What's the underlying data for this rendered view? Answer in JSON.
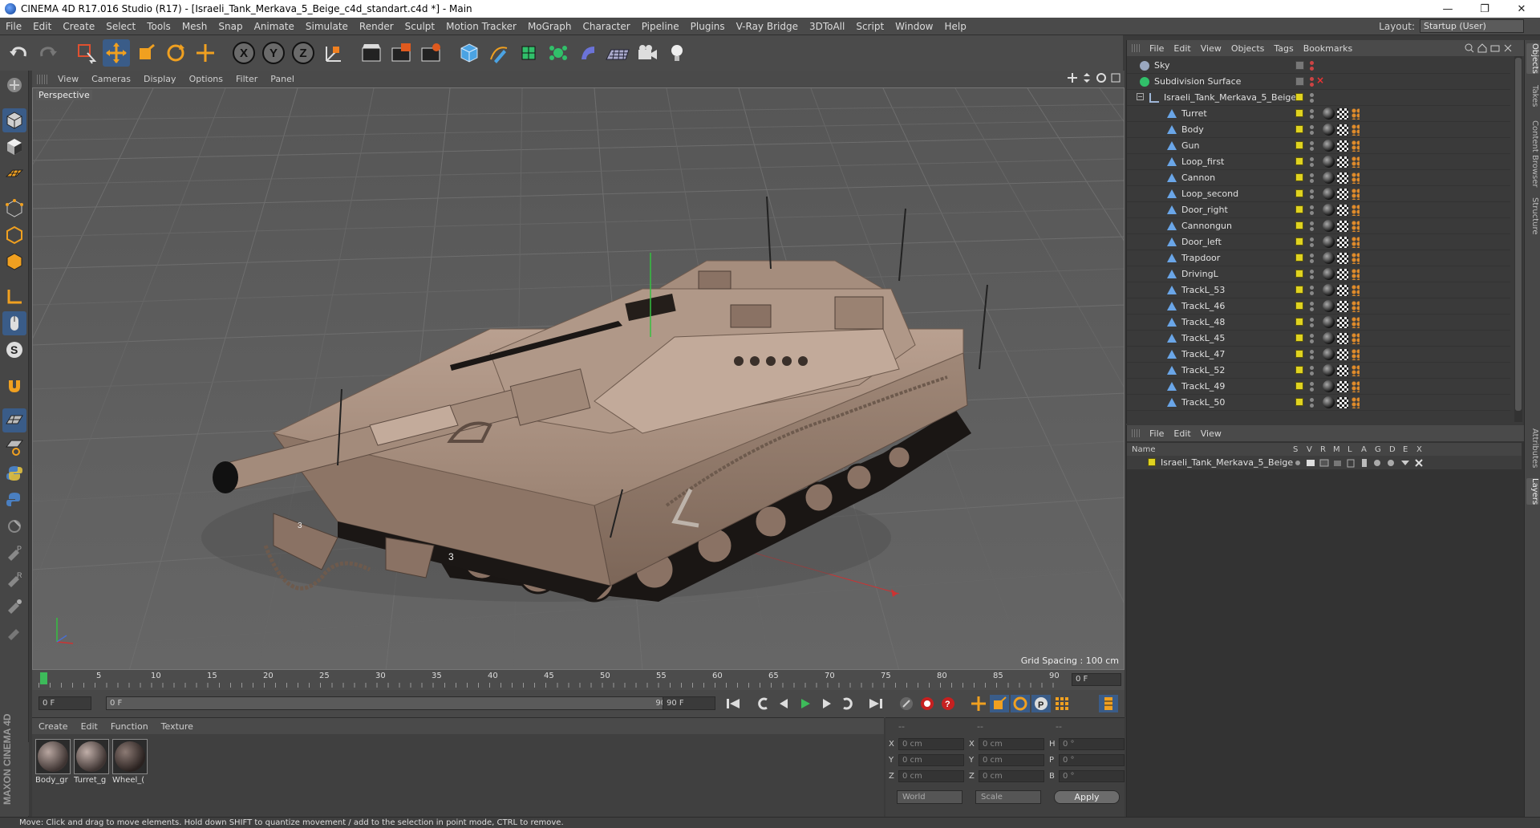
{
  "window": {
    "title": "CINEMA 4D R17.016 Studio (R17) - [Israeli_Tank_Merkava_5_Beige_c4d_standart.c4d *] - Main",
    "minimize": "—",
    "maximize": "❐",
    "close": "✕"
  },
  "menubar": {
    "items": [
      "File",
      "Edit",
      "Create",
      "Select",
      "Tools",
      "Mesh",
      "Snap",
      "Animate",
      "Simulate",
      "Render",
      "Sculpt",
      "Motion Tracker",
      "MoGraph",
      "Character",
      "Pipeline",
      "Plugins",
      "V-Ray Bridge",
      "3DToAll",
      "Script",
      "Window",
      "Help"
    ],
    "layout_label": "Layout:",
    "layout_value": "Startup (User)"
  },
  "toolbar": {
    "icons": [
      "undo-icon",
      "redo-icon",
      "live-select-icon",
      "move-icon",
      "scale-icon",
      "rotate-icon",
      "recent-tool-icon",
      "x-axis-icon",
      "y-axis-icon",
      "z-axis-icon",
      "coord-system-icon",
      "render-view-icon",
      "render-picture-viewer-icon",
      "edit-render-settings-icon",
      "cube-icon",
      "pen-icon",
      "subdivision-icon",
      "array-icon",
      "deformer-icon",
      "floor-icon",
      "camera-icon",
      "light-icon"
    ],
    "axis_x": "X",
    "axis_y": "Y",
    "axis_z": "Z"
  },
  "viewport": {
    "menu": [
      "View",
      "Cameras",
      "Display",
      "Options",
      "Filter",
      "Panel"
    ],
    "label": "Perspective",
    "grid_spacing": "Grid Spacing : 100 cm"
  },
  "timeline": {
    "ticks": [
      "0",
      "5",
      "10",
      "15",
      "20",
      "25",
      "30",
      "35",
      "40",
      "45",
      "50",
      "55",
      "60",
      "65",
      "70",
      "75",
      "80",
      "85",
      "90"
    ],
    "current_frame": "0 F"
  },
  "transport": {
    "start_frame": "0 F",
    "range_start": "0 F",
    "range_end": "90 F",
    "end_frame": "90 F"
  },
  "material_manager": {
    "menu": [
      "Create",
      "Edit",
      "Function",
      "Texture"
    ],
    "materials": [
      {
        "name": "Body_gr"
      },
      {
        "name": "Turret_g"
      },
      {
        "name": "Wheel_("
      }
    ]
  },
  "coordinates": {
    "header": [
      "--",
      "--",
      "--"
    ],
    "rows": [
      {
        "a": "X",
        "av": "0 cm",
        "b": "X",
        "bv": "0 cm",
        "c": "H",
        "cv": "0 °"
      },
      {
        "a": "Y",
        "av": "0 cm",
        "b": "Y",
        "bv": "0 cm",
        "c": "P",
        "cv": "0 °"
      },
      {
        "a": "Z",
        "av": "0 cm",
        "b": "Z",
        "bv": "0 cm",
        "c": "B",
        "cv": "0 °"
      }
    ],
    "mode_world": "World",
    "mode_scale": "Scale",
    "apply": "Apply"
  },
  "object_manager": {
    "menu": [
      "File",
      "Edit",
      "View",
      "Objects",
      "Tags",
      "Bookmarks"
    ],
    "objects": [
      {
        "name": "Sky",
        "level": 0,
        "kind": "sky"
      },
      {
        "name": "Subdivision Surface",
        "level": 0,
        "kind": "subd"
      },
      {
        "name": "Israeli_Tank_Merkava_5_Beige",
        "level": 1,
        "kind": "null"
      },
      {
        "name": "Turret",
        "level": 2,
        "kind": "poly"
      },
      {
        "name": "Body",
        "level": 2,
        "kind": "poly"
      },
      {
        "name": "Gun",
        "level": 2,
        "kind": "poly"
      },
      {
        "name": "Loop_first",
        "level": 2,
        "kind": "poly"
      },
      {
        "name": "Cannon",
        "level": 2,
        "kind": "poly"
      },
      {
        "name": "Loop_second",
        "level": 2,
        "kind": "poly"
      },
      {
        "name": "Door_right",
        "level": 2,
        "kind": "poly"
      },
      {
        "name": "Cannongun",
        "level": 2,
        "kind": "poly"
      },
      {
        "name": "Door_left",
        "level": 2,
        "kind": "poly"
      },
      {
        "name": "Trapdoor",
        "level": 2,
        "kind": "poly"
      },
      {
        "name": "DrivingL",
        "level": 2,
        "kind": "poly"
      },
      {
        "name": "TrackL_53",
        "level": 2,
        "kind": "poly"
      },
      {
        "name": "TrackL_46",
        "level": 2,
        "kind": "poly"
      },
      {
        "name": "TrackL_48",
        "level": 2,
        "kind": "poly"
      },
      {
        "name": "TrackL_45",
        "level": 2,
        "kind": "poly"
      },
      {
        "name": "TrackL_47",
        "level": 2,
        "kind": "poly"
      },
      {
        "name": "TrackL_52",
        "level": 2,
        "kind": "poly"
      },
      {
        "name": "TrackL_49",
        "level": 2,
        "kind": "poly"
      },
      {
        "name": "TrackL_50",
        "level": 2,
        "kind": "poly"
      }
    ]
  },
  "layer_manager": {
    "menu": [
      "File",
      "Edit",
      "View"
    ],
    "columns": [
      "Name",
      "S",
      "V",
      "R",
      "M",
      "L",
      "A",
      "G",
      "D",
      "E",
      "X"
    ],
    "layers": [
      {
        "name": "Israeli_Tank_Merkava_5_Beige",
        "color": "#e0d320"
      }
    ]
  },
  "side_tabs": [
    "Objects",
    "Takes",
    "Content Browser",
    "Structure",
    "Attributes",
    "Layers"
  ],
  "status": "Move: Click and drag to move elements. Hold down SHIFT to quantize movement / add to the selection in point mode, CTRL to remove.",
  "brand": "MAXON CINEMA 4D",
  "colors": {
    "accent": "#3a5c88",
    "layer_yellow": "#e0d320",
    "tank_beige": "#a48a7c",
    "timeline_cursor": "#3dbb5a"
  }
}
